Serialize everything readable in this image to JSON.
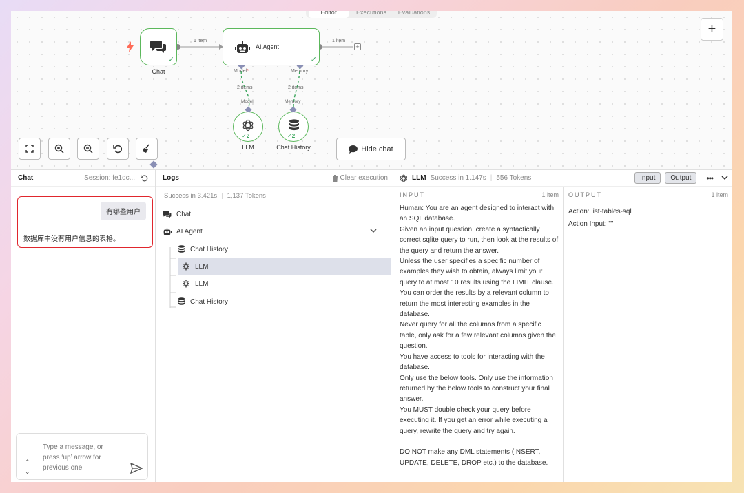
{
  "canvas": {
    "top_tabs": [
      "Editor",
      "Executions",
      "Evaluations"
    ],
    "plus_label": "+",
    "nodes": {
      "chat": {
        "label": "Chat"
      },
      "agent": {
        "label": "AI Agent"
      },
      "llm": {
        "label": "LLM",
        "count": "2"
      },
      "chat_history": {
        "label": "Chat History",
        "count": "2"
      }
    },
    "edges": {
      "chat_to_agent": "1 item",
      "agent_out": "1 item",
      "model_port": "Model",
      "model_required": "*",
      "memory_port": "Memory",
      "model_items": "2 items",
      "memory_items": "2 items",
      "model_in": "Model",
      "memory_in": "Memory"
    },
    "hide_chat_label": "Hide chat"
  },
  "chat": {
    "title": "Chat",
    "session": "Session: fe1dc...",
    "user_message": "有哪些用户",
    "bot_message": "数据库中没有用户信息的表格。",
    "input_placeholder": "Type a message, or press ‘up’ arrow for previous one"
  },
  "logs": {
    "title": "Logs",
    "clear_label": "Clear execution",
    "summary_time": "Success in 3.421s",
    "summary_tokens": "1,137 Tokens",
    "items": [
      {
        "label": "Chat",
        "icon": "chat-icon"
      },
      {
        "label": "AI Agent",
        "icon": "robot-icon"
      },
      {
        "label": "Chat History",
        "icon": "database-icon"
      },
      {
        "label": "LLM",
        "icon": "openai-icon"
      },
      {
        "label": "LLM",
        "icon": "openai-icon"
      },
      {
        "label": "Chat History",
        "icon": "database-icon"
      }
    ]
  },
  "detail": {
    "title": "LLM",
    "status": "Success in 1.147s",
    "tokens": "556 Tokens",
    "input_btn": "Input",
    "output_btn": "Output",
    "input_heading": "INPUT",
    "input_count": "1 item",
    "output_heading": "OUTPUT",
    "output_count": "1 item",
    "input_text": "Human: You are an agent designed to interact with an SQL database.\nGiven an input question, create a syntactically correct sqlite query to run, then look at the results of the query and return the answer.\nUnless the user specifies a specific number of examples they wish to obtain, always limit your query to at most 10 results using the LIMIT clause.\nYou can order the results by a relevant column to return the most interesting examples in the database.\nNever query for all the columns from a specific table, only ask for a few relevant columns given the question.\nYou have access to tools for interacting with the database.\nOnly use the below tools. Only use the information returned by the below tools to construct your final answer.\nYou MUST double check your query before executing it. If you get an error while executing a query, rewrite the query and try again.\n\nDO NOT make any DML statements (INSERT, UPDATE, DELETE, DROP etc.) to the database.",
    "output_action": "Action: list-tables-sql",
    "output_action_input": "Action Input: \"\""
  },
  "colors": {
    "node_border": "#5cb85c",
    "trigger": "#ff6b57",
    "highlight": "#e0262d",
    "port": "#8a8fb5"
  }
}
